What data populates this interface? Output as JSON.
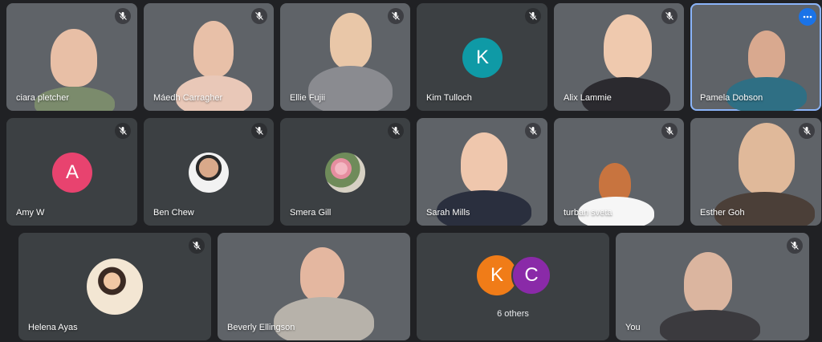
{
  "participants": {
    "row1": [
      {
        "name": "ciara pletcher"
      },
      {
        "name": "Máedh Carragher"
      },
      {
        "name": "Ellie Fujii"
      },
      {
        "name": "Kim Tulloch",
        "initial": "K",
        "color": "#0f9aa6"
      },
      {
        "name": "Alix Lammie"
      },
      {
        "name": "Pamela Dobson"
      }
    ],
    "row2": [
      {
        "name": "Amy W",
        "initial": "A",
        "color": "#e8436f"
      },
      {
        "name": "Ben Chew"
      },
      {
        "name": "Smera Gill"
      },
      {
        "name": "Sarah Mills"
      },
      {
        "name": "turban sveta"
      },
      {
        "name": "Esther Goh"
      }
    ],
    "row3": [
      {
        "name": "Helena Ayas"
      },
      {
        "name": "Beverly Ellingson"
      },
      {
        "name": "others_initials",
        "initials": [
          "K",
          "C"
        ],
        "colors": [
          "#f07c18",
          "#8a2aa8"
        ],
        "label": "6 others"
      },
      {
        "name": "You"
      }
    ]
  },
  "colors": {
    "background": "#202124",
    "tile": "#3c4043",
    "active_border": "#8ab4f8",
    "more_button": "#1a73e8"
  },
  "icons": {
    "mute": "mic-off-icon",
    "more": "more-options-icon"
  }
}
